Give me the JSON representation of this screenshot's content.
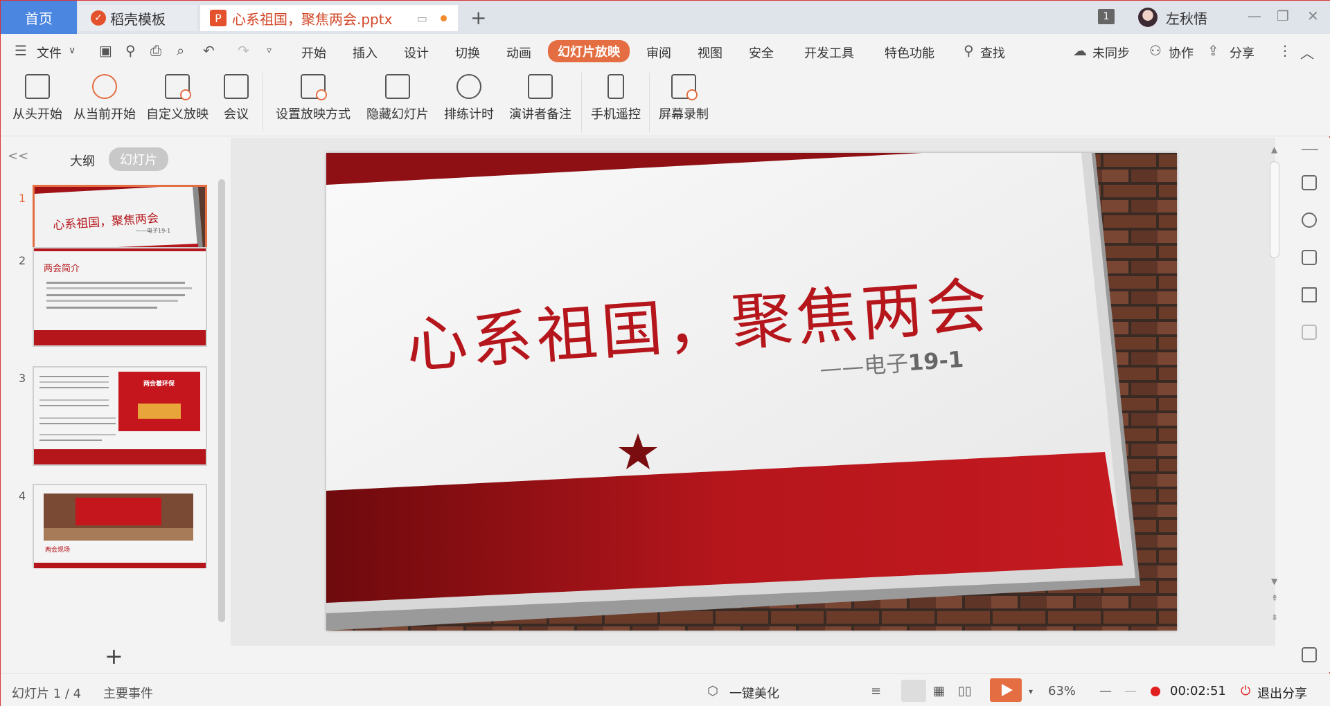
{
  "titlebar": {
    "home_tab": "首页",
    "template_tab": "稻壳模板",
    "file_tab": "心系祖国，聚焦两会.pptx",
    "new_tab": "+",
    "page_count": "1",
    "username": "左秋悟",
    "minimize": "—",
    "restore": "❐",
    "close": "✕"
  },
  "menubar": {
    "file": "文件",
    "items": [
      "开始",
      "插入",
      "设计",
      "切换",
      "动画",
      "幻灯片放映",
      "审阅",
      "视图",
      "安全",
      "开发工具",
      "特色功能"
    ],
    "search": "查找",
    "sync": "未同步",
    "collab": "协作",
    "share": "分享"
  },
  "ribbon": {
    "buttons": [
      "从头开始",
      "从当前开始",
      "自定义放映",
      "会议",
      "设置放映方式",
      "隐藏幻灯片",
      "排练计时",
      "演讲者备注",
      "手机遥控",
      "屏幕录制"
    ]
  },
  "leftpanel": {
    "collapse": "<<",
    "outline_tab": "大纲",
    "slides_tab": "幻灯片",
    "add": "+",
    "thumbs": [
      {
        "num": "1",
        "title": "心系祖国，聚焦两会",
        "sub": "——电子19-1"
      },
      {
        "num": "2",
        "title": "两会简介"
      },
      {
        "num": "3",
        "title": "两会着环保"
      },
      {
        "num": "4",
        "title": "两会现场"
      }
    ]
  },
  "slide": {
    "title": "心系祖国，聚焦两会",
    "subtitle_prefix": "——电子",
    "subtitle_num": "19-1"
  },
  "statusbar": {
    "slide_info": "幻灯片 1 / 4",
    "notes": "主要事件",
    "beautify": "一键美化",
    "zoom": "63%",
    "time": "00:02:51",
    "exit_share": "退出分享"
  },
  "colors": {
    "accent": "#e46e42",
    "slide_red": "#b5161c",
    "home_blue": "#4b86e0"
  }
}
